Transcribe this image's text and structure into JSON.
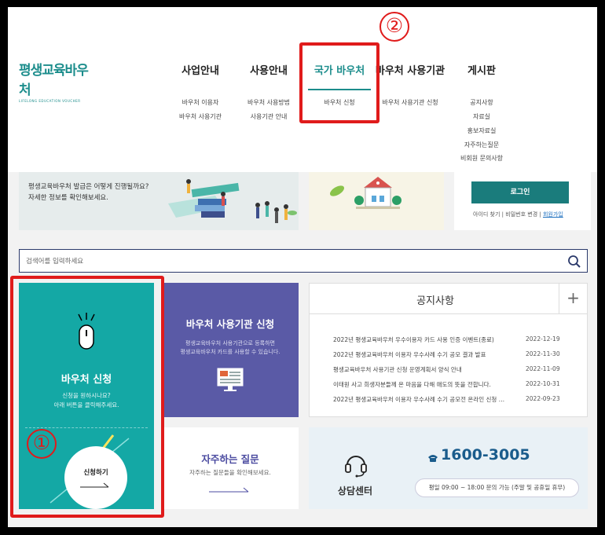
{
  "logo": {
    "main": "평생교육바우처",
    "sub": "LIFELONG EDUCATION VOUCHER"
  },
  "nav": {
    "menus": [
      {
        "label": "사업안내",
        "items": [
          "바우처 이용자",
          "바우처 사용기관"
        ]
      },
      {
        "label": "사용안내",
        "items": [
          "바우처 사용방법",
          "사용기관 안내"
        ]
      },
      {
        "label": "국가 바우처",
        "items": [
          "바우처 신청"
        ]
      },
      {
        "label": "바우처 사용기관",
        "items": [
          "바우처 사용기관 신청"
        ]
      },
      {
        "label": "게시판",
        "items": [
          "공지사항",
          "자료실",
          "홍보자료실",
          "자주하는질문",
          "비회원 문의사항"
        ]
      }
    ]
  },
  "annotations": {
    "one": "①",
    "two": "②"
  },
  "banner": {
    "line1": "평생교육바우처 발급은 어떻게 진행될까요?",
    "line2": "자세한 정보를 확인해보세요."
  },
  "login": {
    "button": "로그인",
    "find_id": "아이디 찾기",
    "sep": "|",
    "change_pw": "비밀번호 변경",
    "join": "회원가입"
  },
  "search": {
    "placeholder": "검색어를 입력하세요"
  },
  "apply_tile": {
    "title": "바우처 신청",
    "desc1": "신청을 원하시나요?",
    "desc2": "아래 버튼을 클릭해주세요.",
    "button": "신청하기"
  },
  "institution_tile": {
    "title": "바우처 사용기관 신청",
    "desc1": "평생교육바우처 사용기관으로 등록하면",
    "desc2": "평생교육바우처 카드를 사용할 수 있습니다."
  },
  "notice": {
    "title": "공지사항",
    "more": "+",
    "rows": [
      {
        "text": "2022년 평생교육바우처 우수이용자 카드 사용 인증 이벤트(종료)",
        "date": "2022-12-19"
      },
      {
        "text": "2022년 평생교육바우처 이용자 우수사례 수기 공모 결과 발표",
        "date": "2022-11-30"
      },
      {
        "text": "평생교육바우처 사용기관 신청 운영계획서 양식 안내",
        "date": "2022-11-09"
      },
      {
        "text": "이태원 사고 희생자분들께 온 마음을 다해 애도의 뜻을 전합니다.",
        "date": "2022-10-31"
      },
      {
        "text": "2022년 평생교육바우처 이용자 우수사례 수기 공모전 온라인 신청 …",
        "date": "2022-09-23"
      }
    ]
  },
  "faq_tile": {
    "title": "자주하는 질문",
    "desc": "자주하는 질문들을 확인해보세요."
  },
  "callcenter": {
    "title": "상담센터",
    "phone": "1600-3005",
    "hours": "평일 09:00 ~ 18:00 문의 가능 (주말 및 공휴일 휴무)"
  },
  "colors": {
    "teal": "#14a8a5",
    "purple": "#5a5aa6",
    "annotation_red": "#e01b1b"
  }
}
